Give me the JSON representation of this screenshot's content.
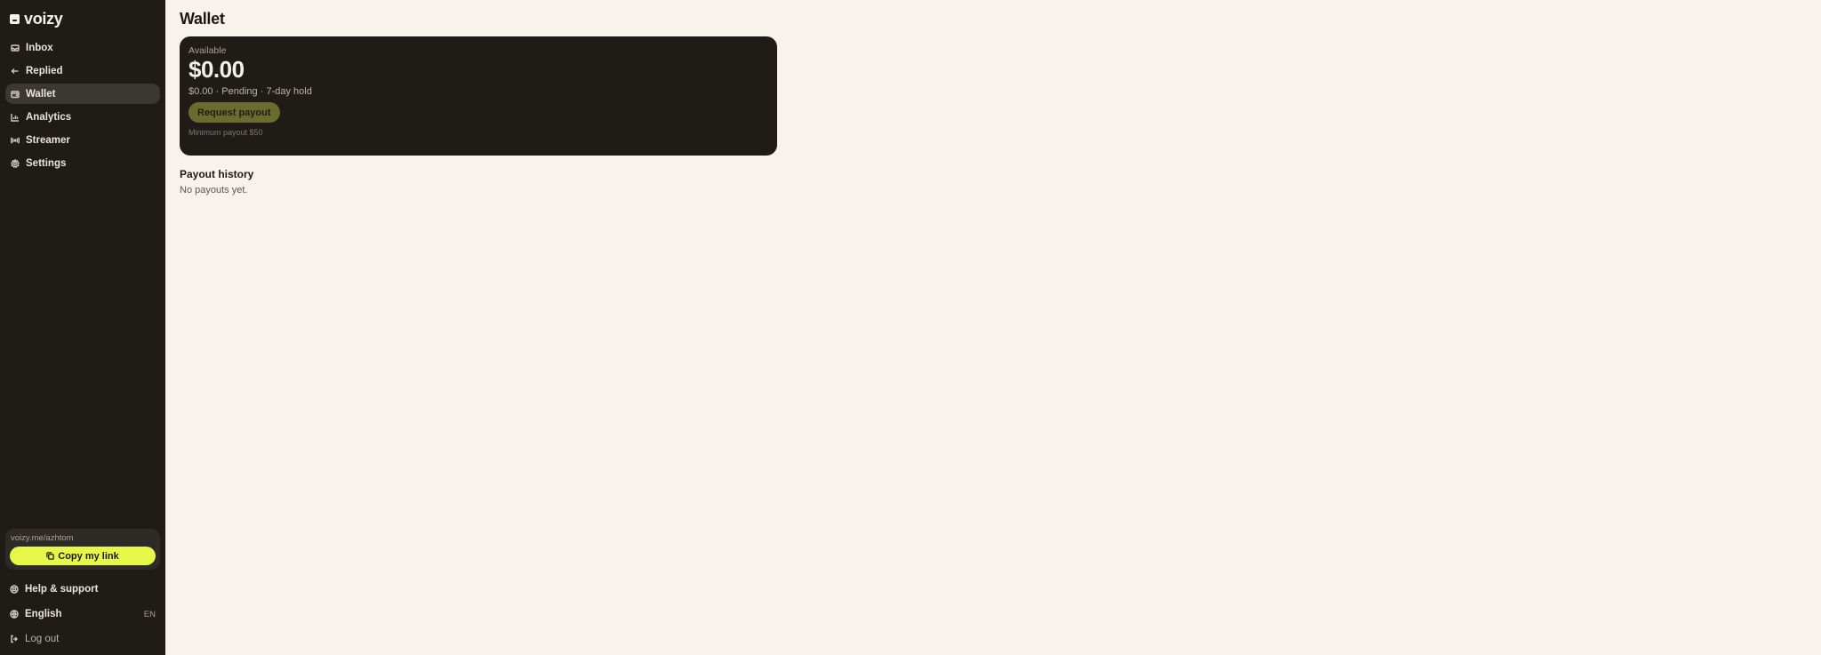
{
  "brand": {
    "name": "voizy",
    "logo_icon": "voizy-logo-icon"
  },
  "sidebar": {
    "items": [
      {
        "label": "Inbox",
        "icon": "inbox-icon",
        "active": false
      },
      {
        "label": "Replied",
        "icon": "reply-icon",
        "active": false
      },
      {
        "label": "Wallet",
        "icon": "wallet-icon",
        "active": true
      },
      {
        "label": "Analytics",
        "icon": "chart-icon",
        "active": false
      },
      {
        "label": "Streamer",
        "icon": "broadcast-icon",
        "active": false
      },
      {
        "label": "Settings",
        "icon": "gear-icon",
        "active": false
      }
    ],
    "link_card": {
      "url": "voizy.me/azhtom",
      "copy_label": "Copy my link"
    },
    "footer": {
      "help_label": "Help & support",
      "language_label": "English",
      "language_code": "EN",
      "logout_label": "Log out"
    }
  },
  "main": {
    "title": "Wallet",
    "wallet": {
      "available_label": "Available",
      "amount": "$0.00",
      "pending_text": "$0.00 · Pending · 7-day hold",
      "payout_button": "Request payout",
      "minimum_text": "Minimum payout $50"
    },
    "history": {
      "title": "Payout history",
      "empty_text": "No payouts yet."
    }
  },
  "colors": {
    "sidebar_bg": "#1f1b17",
    "page_bg": "#f7f3ec",
    "accent": "#e6f74a",
    "active_item_bg": "#3b3732",
    "payout_button_bg": "#6c6b2f"
  }
}
